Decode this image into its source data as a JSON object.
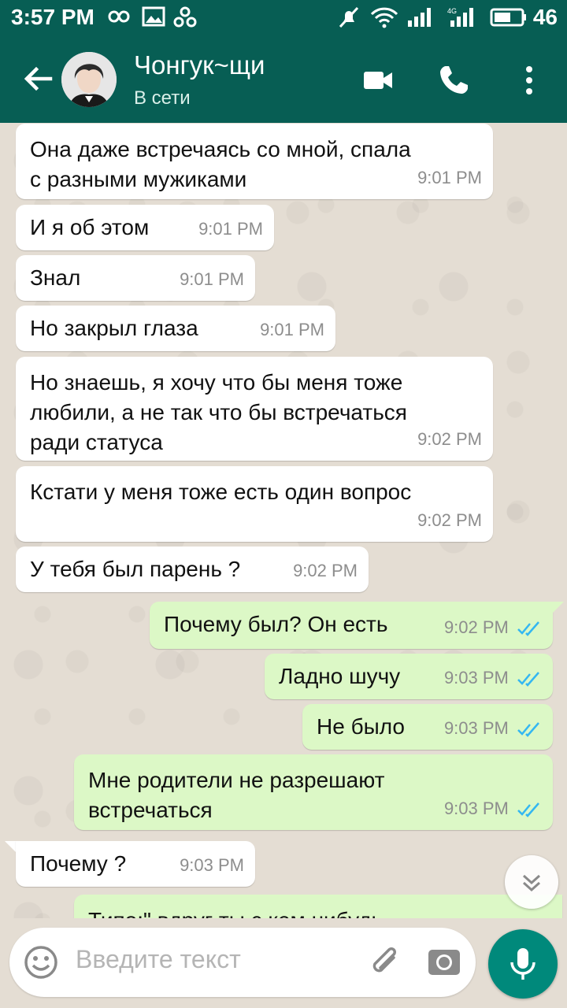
{
  "status_bar": {
    "time": "3:57 PM",
    "battery": "46",
    "icons": [
      "infinity-icon",
      "gallery-icon",
      "link-icon",
      "mute-icon",
      "wifi-icon",
      "signal-icon",
      "signal-4g-icon",
      "battery-icon"
    ]
  },
  "header": {
    "contact_name": "Чонгук~щи",
    "status": "В сети",
    "icons": [
      "back-arrow-icon",
      "avatar",
      "video-call-icon",
      "phone-icon",
      "more-vert-icon"
    ]
  },
  "messages": [
    {
      "id": "m1",
      "dir": "in",
      "text": "Она даже встречаясь со мной, спала\nс разными мужиками",
      "time": "9:01 PM"
    },
    {
      "id": "m2",
      "dir": "in",
      "text": "И я об этом",
      "time": "9:01 PM"
    },
    {
      "id": "m3",
      "dir": "in",
      "text": "Знал",
      "time": "9:01 PM"
    },
    {
      "id": "m4",
      "dir": "in",
      "text": "Но закрыл глаза",
      "time": "9:01 PM"
    },
    {
      "id": "m5",
      "dir": "in",
      "text": "Но знаешь, я хочу что бы меня тоже\nлюбили, а не так что бы встречаться\nради статуса",
      "time": "9:02 PM"
    },
    {
      "id": "m6",
      "dir": "in",
      "text": "Кстати у меня тоже есть один вопрос",
      "time": "9:02 PM"
    },
    {
      "id": "m7",
      "dir": "in",
      "text": "У тебя был парень ?",
      "time": "9:02 PM"
    },
    {
      "id": "m8",
      "dir": "out",
      "text": "Почему был? Он есть",
      "time": "9:02 PM",
      "read": true
    },
    {
      "id": "m9",
      "dir": "out",
      "text": "Ладно шучу",
      "time": "9:03 PM",
      "read": true
    },
    {
      "id": "m10",
      "dir": "out",
      "text": "Не было",
      "time": "9:03 PM",
      "read": true
    },
    {
      "id": "m11",
      "dir": "out",
      "text": "Мне родители не разрешают\nвстречаться",
      "time": "9:03 PM",
      "read": true
    },
    {
      "id": "m12",
      "dir": "in",
      "text": "Почему ?",
      "time": "9:03 PM"
    },
    {
      "id": "m13",
      "dir": "out",
      "text": "Типо:\" вдруг ты с кем нибудь",
      "time": "",
      "read": false
    }
  ],
  "composer": {
    "placeholder": "Введите текст",
    "icons": [
      "emoji-icon",
      "attach-icon",
      "camera-icon",
      "mic-icon"
    ]
  },
  "colors": {
    "header": "#075e54",
    "outgoing_bubble": "#dcf8c6",
    "incoming_bubble": "#ffffff",
    "read_ticks": "#34b7f1",
    "mic_button": "#00897b"
  }
}
